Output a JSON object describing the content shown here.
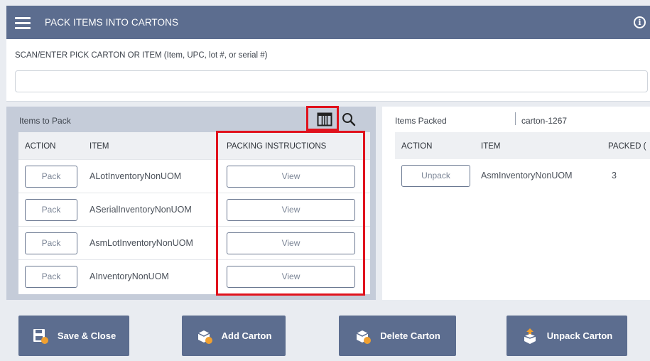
{
  "header": {
    "title": "PACK ITEMS INTO CARTONS"
  },
  "scan": {
    "label": "SCAN/ENTER PICK CARTON OR ITEM (Item, UPC, lot #, or serial #)",
    "value": ""
  },
  "left": {
    "title": "Items to Pack",
    "columns": [
      "ACTION",
      "ITEM",
      "PACKING INSTRUCTIONS"
    ],
    "rows": [
      {
        "action": "Pack",
        "item": "ALotInventoryNonUOM",
        "instructions": "View"
      },
      {
        "action": "Pack",
        "item": "ASerialInventoryNonUOM",
        "instructions": "View"
      },
      {
        "action": "Pack",
        "item": "AsmLotInventoryNonUOM",
        "instructions": "View"
      },
      {
        "action": "Pack",
        "item": "AInventoryNonUOM",
        "instructions": "View"
      }
    ]
  },
  "right": {
    "title": "Items Packed",
    "carton": "carton-1267",
    "columns": [
      "ACTION",
      "ITEM",
      "PACKED ("
    ],
    "rows": [
      {
        "action": "Unpack",
        "item": "AsmInventoryNonUOM",
        "packed": "3"
      }
    ]
  },
  "footer": {
    "save_close": "Save & Close",
    "add_carton": "Add Carton",
    "delete_carton": "Delete Carton",
    "unpack_carton": "Unpack Carton"
  },
  "colors": {
    "header": "#5c6d8f",
    "highlight": "#e0121d",
    "panel": "#c5ccd9"
  },
  "icons": [
    "menu-icon",
    "info-icon",
    "columns-icon",
    "search-icon",
    "save-icon",
    "add-carton-icon",
    "delete-carton-icon",
    "unpack-carton-icon"
  ]
}
